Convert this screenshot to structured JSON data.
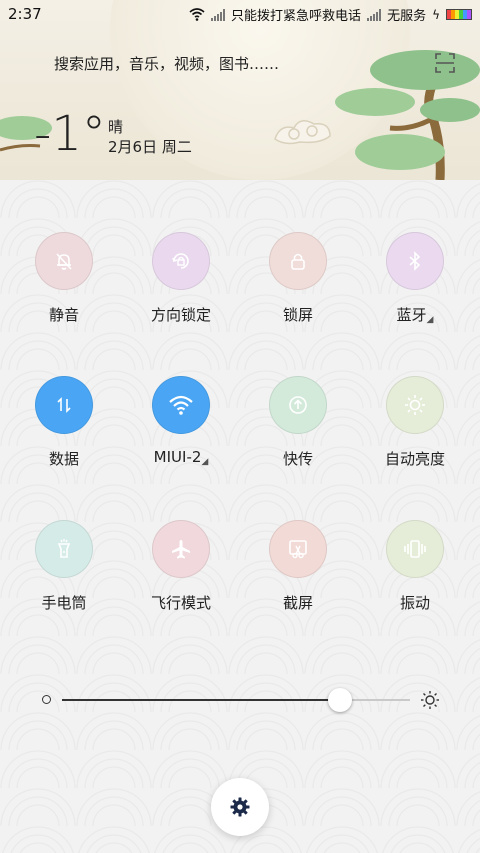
{
  "status_bar": {
    "time": "2:37",
    "sim1_text": "只能拨打紧急呼救电话",
    "sim2_text": "无服务"
  },
  "search": {
    "placeholder": "搜索应用，音乐，视频，图书……",
    "scan_icon": "scan-icon"
  },
  "weather": {
    "temperature": "-1°",
    "condition": "晴",
    "date": "2月6日 周二"
  },
  "toggles": [
    {
      "label": "静音",
      "icon": "bell-off-icon",
      "bg": "#eed9dc",
      "has_more": false
    },
    {
      "label": "方向锁定",
      "icon": "rotation-lock-icon",
      "bg": "#ead9ee",
      "has_more": false
    },
    {
      "label": "锁屏",
      "icon": "lock-icon",
      "bg": "#f0dcd8",
      "has_more": false
    },
    {
      "label": "蓝牙",
      "icon": "bluetooth-icon",
      "bg": "#ead9ef",
      "has_more": true
    },
    {
      "label": "数据",
      "icon": "data-icon",
      "bg": "#4aa6f4",
      "has_more": false
    },
    {
      "label": "MIUI-2",
      "icon": "wifi-icon",
      "bg": "#4aa6f4",
      "has_more": true
    },
    {
      "label": "快传",
      "icon": "transfer-icon",
      "bg": "#d3eadb",
      "has_more": false
    },
    {
      "label": "自动亮度",
      "icon": "brightness-auto-icon",
      "bg": "#e5edd8",
      "has_more": false
    },
    {
      "label": "手电筒",
      "icon": "flashlight-icon",
      "bg": "#d5ebe7",
      "has_more": false
    },
    {
      "label": "飞行模式",
      "icon": "airplane-icon",
      "bg": "#f0d8dc",
      "has_more": false
    },
    {
      "label": "截屏",
      "icon": "screenshot-icon",
      "bg": "#f2dad6",
      "has_more": false
    },
    {
      "label": "振动",
      "icon": "vibrate-icon",
      "bg": "#e5edd8",
      "has_more": false
    }
  ],
  "brightness": {
    "value": 0.8
  },
  "settings_button": "settings-gear-icon",
  "more_indicator": "◢"
}
